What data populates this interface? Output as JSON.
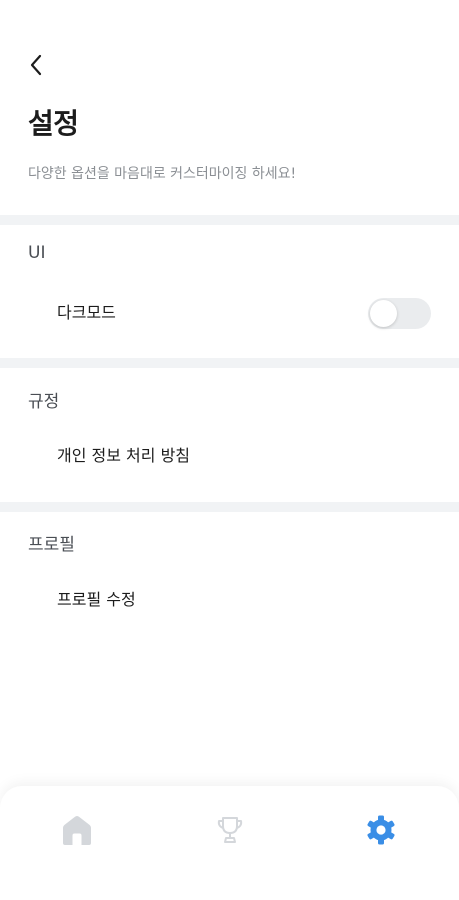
{
  "header": {
    "back_icon": "chevron-left-icon",
    "title": "설정",
    "subtitle": "다양한 옵션을 마음대로 커스터마이징 하세요!"
  },
  "sections": [
    {
      "title": "UI",
      "items": [
        {
          "label": "다크모드",
          "control": "toggle",
          "value": false
        }
      ]
    },
    {
      "title": "규정",
      "items": [
        {
          "label": "개인 정보 처리 방침"
        }
      ]
    },
    {
      "title": "프로필",
      "items": [
        {
          "label": "프로필 수정"
        }
      ]
    }
  ],
  "bottom_nav": {
    "items": [
      {
        "icon": "home-icon",
        "active": false
      },
      {
        "icon": "trophy-icon",
        "active": false
      },
      {
        "icon": "gear-icon",
        "active": true
      }
    ]
  },
  "colors": {
    "accent": "#3a8ee6",
    "inactive_icon": "#d4d7db",
    "divider": "#f1f3f5",
    "toggle_off": "#eaecee"
  }
}
